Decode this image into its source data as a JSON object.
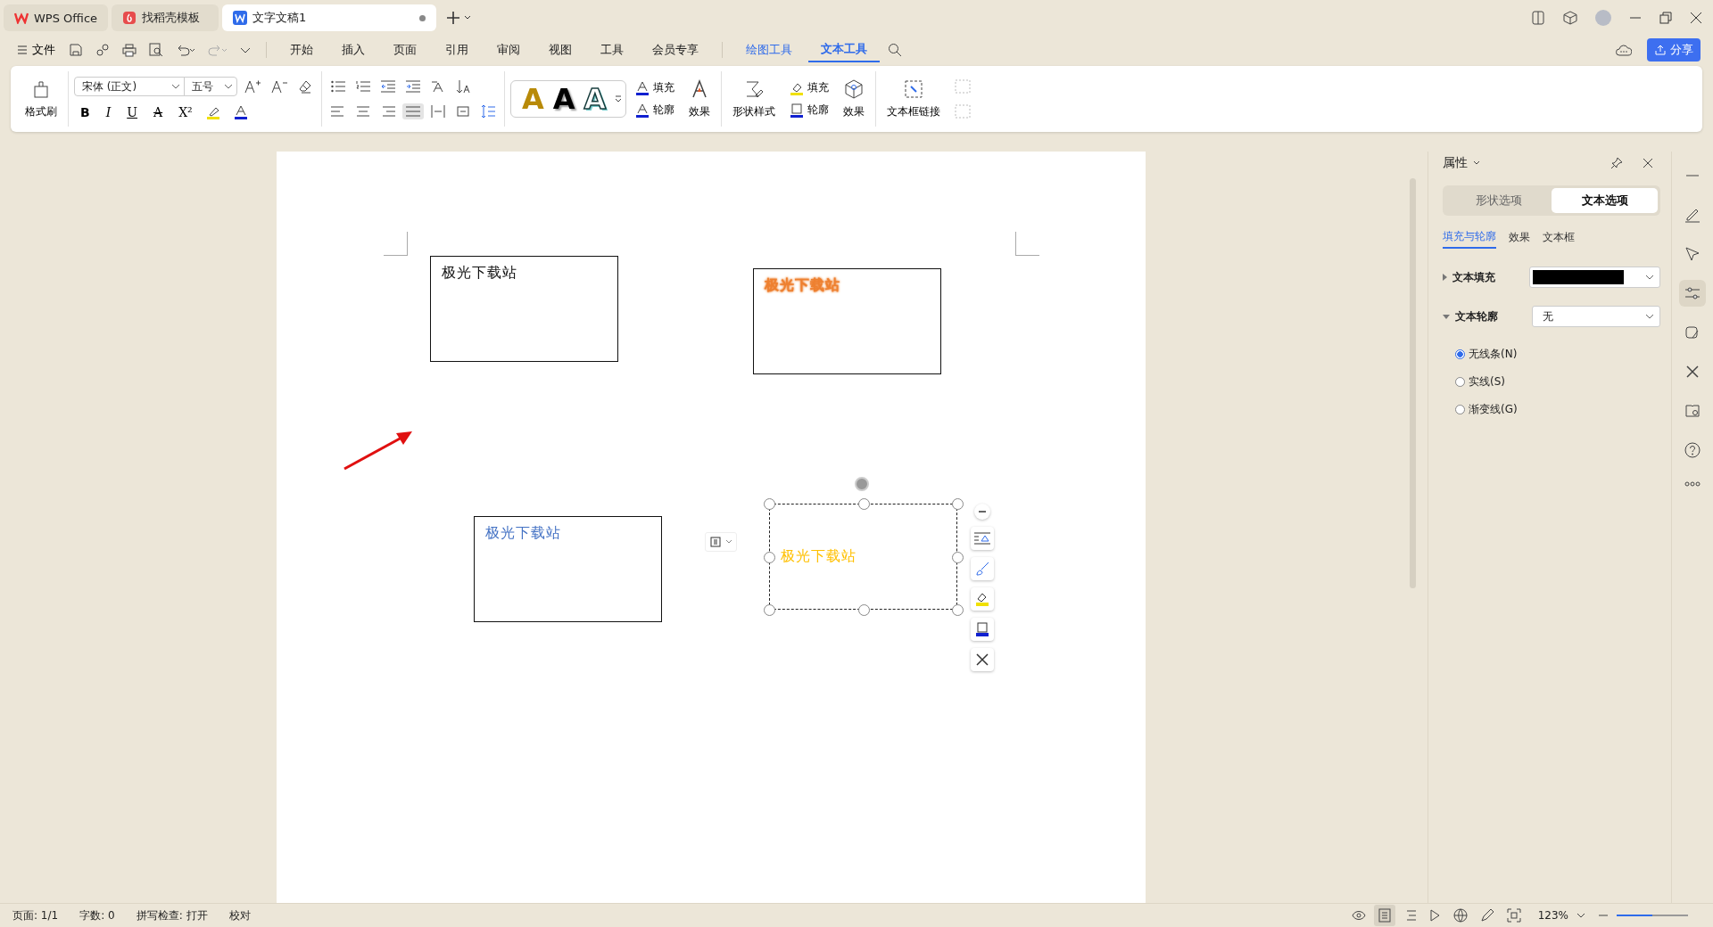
{
  "tabs": [
    {
      "label": "WPS Office",
      "kind": "home",
      "selected": false
    },
    {
      "label": "找稻壳模板",
      "kind": "template",
      "selected": false
    },
    {
      "label": "文字文稿1",
      "kind": "doc",
      "selected": true
    }
  ],
  "menu": {
    "file": "文件",
    "items": [
      {
        "label": "开始",
        "kind": "normal",
        "selected": false
      },
      {
        "label": "插入",
        "kind": "normal",
        "selected": false
      },
      {
        "label": "页面",
        "kind": "normal",
        "selected": false
      },
      {
        "label": "引用",
        "kind": "normal",
        "selected": false
      },
      {
        "label": "审阅",
        "kind": "normal",
        "selected": false
      },
      {
        "label": "视图",
        "kind": "normal",
        "selected": false
      },
      {
        "label": "工具",
        "kind": "normal",
        "selected": false
      },
      {
        "label": "会员专享",
        "kind": "normal",
        "selected": false
      },
      {
        "label": "绘图工具",
        "kind": "context",
        "selected": false
      },
      {
        "label": "文本工具",
        "kind": "context",
        "selected": true
      }
    ],
    "share": "分享"
  },
  "ribbon": {
    "format_painter": "格式刷",
    "font": "宋体 (正文)",
    "size": "五号",
    "format_glyphs": [
      "B",
      "I",
      "U",
      "A",
      "X²"
    ],
    "style_samples": [
      {
        "letter": "A",
        "kind": "gold"
      },
      {
        "letter": "A",
        "kind": "shadow"
      },
      {
        "letter": "A",
        "kind": "outline"
      }
    ],
    "text_fill": "填充",
    "text_outline": "轮廓",
    "text_effect": "效果",
    "shape_style": "形状样式",
    "shape_fill": "填充",
    "shape_outline": "轮廓",
    "shape_effect": "效果",
    "textbox_link": "文本框链接"
  },
  "canvas": {
    "textboxes": [
      {
        "text": "极光下载站",
        "color": "#111111",
        "kind": "plain",
        "selected": false
      },
      {
        "text": "极光下载站",
        "color": "#ee8030",
        "kind": "glow",
        "selected": false
      },
      {
        "text": "极光下载站",
        "color": "#4472c4",
        "kind": "plain",
        "selected": false
      },
      {
        "text": "极光下载站",
        "color": "#ffc000",
        "kind": "plain",
        "selected": true
      }
    ]
  },
  "panel": {
    "title": "属性",
    "tabs": [
      {
        "label": "形状选项",
        "selected": false
      },
      {
        "label": "文本选项",
        "selected": true
      }
    ],
    "subtabs": [
      {
        "label": "填充与轮廓",
        "selected": true
      },
      {
        "label": "效果",
        "selected": false
      },
      {
        "label": "文本框",
        "selected": false
      }
    ],
    "fill": {
      "label": "文本填充",
      "expanded": false,
      "color": "#000000"
    },
    "outline": {
      "label": "文本轮廓",
      "expanded": true,
      "value": "无"
    },
    "radios": [
      {
        "label": "无线条(N)",
        "selected": true
      },
      {
        "label": "实线(S)",
        "selected": false
      },
      {
        "label": "渐变线(G)",
        "selected": false
      }
    ]
  },
  "status_bar": {
    "items": [
      "页面: 1/1",
      "字数: 0",
      "拼写检查: 打开",
      "校对"
    ],
    "zoom": "123%",
    "zoom_slider": {
      "level": 0.5
    }
  }
}
